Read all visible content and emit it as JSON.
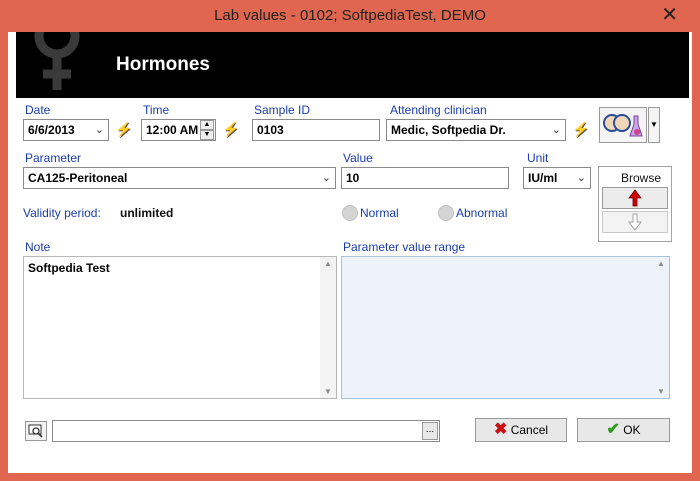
{
  "window": {
    "title": "Lab values - 0102; SoftpediaTest, DEMO",
    "close_glyph": "✕"
  },
  "banner": {
    "title": "Hormones"
  },
  "date": {
    "label": "Date",
    "value": "6/6/2013"
  },
  "time": {
    "label": "Time",
    "value": "12:00 AM"
  },
  "sample": {
    "label": "Sample ID",
    "value": "0103"
  },
  "clinician": {
    "label": "Attending clinician",
    "value": "Medic, Softpedia Dr."
  },
  "parameter": {
    "label": "Parameter",
    "value": "CA125-Peritoneal"
  },
  "value_field": {
    "label": "Value",
    "value": "10"
  },
  "unit": {
    "label": "Unit",
    "value": "IU/ml"
  },
  "browse": {
    "label": "Browse"
  },
  "validity": {
    "label": "Validity period:",
    "value": "unlimited"
  },
  "radios": {
    "normal": "Normal",
    "abnormal": "Abnormal"
  },
  "note": {
    "label": "Note",
    "value": "Softpedia Test"
  },
  "range": {
    "label": "Parameter value range"
  },
  "buttons": {
    "cancel": "Cancel",
    "ok": "OK",
    "ellipsis": "..."
  },
  "colors": {
    "titlebar": "#e0664f",
    "banner": "#000000",
    "label_blue": "#1a3ea8",
    "bolt": "#e2c500",
    "ok_check": "#2e9a1e",
    "cancel_x": "#cc1010",
    "browse_up": "#d40000"
  }
}
